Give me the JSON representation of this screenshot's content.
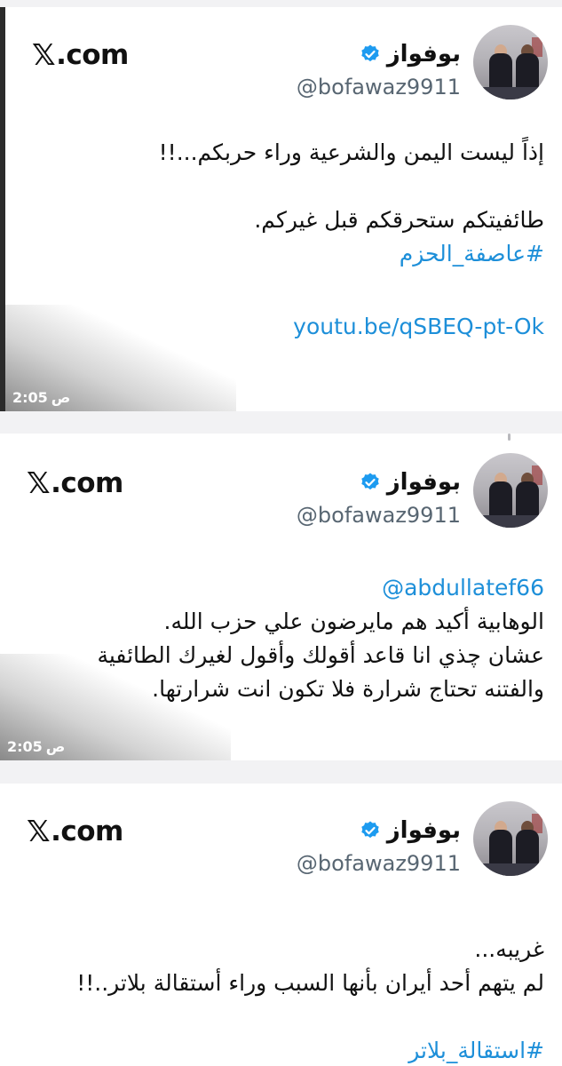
{
  "tweets": [
    {
      "brand": ".com",
      "brand_logo": "𝕏",
      "display_name": "بوفواز",
      "handle": "@bofawaz9911",
      "lines": [
        {
          "text": "إذاً ليست اليمن والشرعية وراء حربكم...!!",
          "style": "normal"
        },
        {
          "text": "",
          "style": "normal"
        },
        {
          "text": "طائفيتكم ستحرقكم قبل غيركم.",
          "style": "normal"
        },
        {
          "text": "#عاصفة_الحزم",
          "style": "link"
        },
        {
          "text": "",
          "style": "normal"
        },
        {
          "text": "youtu.be/qSBEQ-pt-Ok",
          "style": "link-ltr"
        }
      ],
      "time": "2:05",
      "time_suffix": "ص"
    },
    {
      "brand": ".com",
      "brand_logo": "𝕏",
      "display_name": "بوفواز",
      "handle": "@bofawaz9911",
      "lines": [
        {
          "text": "@abdullatef66",
          "style": "link-ltr"
        },
        {
          "text": "الوهابية أكيد هم مايرضون علي حزب الله.",
          "style": "normal"
        },
        {
          "text": "عشان چذي انا قاعد أقولك وأقول لغيرك الطائفية",
          "style": "normal"
        },
        {
          "text": "والفتنه تحتاج شرارة فلا تكون انت شرارتها.",
          "style": "normal"
        }
      ],
      "time": "2:05",
      "time_suffix": "ص"
    },
    {
      "brand": ".com",
      "brand_logo": "𝕏",
      "display_name": "بوفواز",
      "handle": "@bofawaz9911",
      "lines": [
        {
          "text": "غريبه...",
          "style": "normal"
        },
        {
          "text": "لم يتهم أحد أيران بأنها السبب وراء أستقالة بلاتر..!!",
          "style": "normal"
        },
        {
          "text": "",
          "style": "normal"
        },
        {
          "text": "#استقالة_بلاتر",
          "style": "link"
        }
      ]
    }
  ],
  "colors": {
    "link": "#1d8fd9",
    "verified": "#1d9bf0",
    "handle": "#586672"
  },
  "icons": {
    "brand": "x-logo-icon",
    "verified": "verified-badge-icon",
    "avatar": "profile-photo"
  }
}
